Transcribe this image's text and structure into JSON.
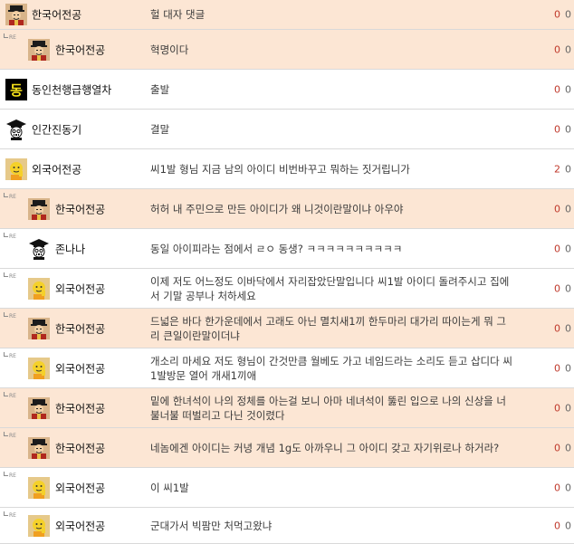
{
  "labels": {
    "reply_marker": "RE"
  },
  "comments": [
    {
      "nick": "한국어전공",
      "avatar": "king",
      "reply": false,
      "hl": true,
      "text": "헐 대자 댓글",
      "c1": "0",
      "c2": "0"
    },
    {
      "nick": "한국어전공",
      "avatar": "king",
      "reply": true,
      "hl": true,
      "text": "혁명이다",
      "c1": "0",
      "c2": "0"
    },
    {
      "nick": "동인천행급행열차",
      "avatar": "dong",
      "reply": false,
      "hl": false,
      "text": "출발",
      "c1": "0",
      "c2": "0"
    },
    {
      "nick": "인간진동기",
      "avatar": "grad",
      "reply": false,
      "hl": false,
      "text": "결말",
      "c1": "0",
      "c2": "0"
    },
    {
      "nick": "외국어전공",
      "avatar": "yellow",
      "reply": false,
      "hl": false,
      "text": "씨1발 형님 지금 남의 아이디 비번바꾸고 뭐하는 짓거립니가",
      "c1": "2",
      "c2": "0"
    },
    {
      "nick": "한국어전공",
      "avatar": "king",
      "reply": true,
      "hl": true,
      "text": "허허 내 주민으로 만든 아이디가 왜 니것이란말이냐 아우야",
      "c1": "0",
      "c2": "0"
    },
    {
      "nick": "존나나",
      "avatar": "grad",
      "reply": true,
      "hl": false,
      "text": "동일 아이피라는 점에서 ㄹㅇ 동생? ㅋㅋㅋㅋㅋㅋㅋㅋㅋㅋ",
      "c1": "0",
      "c2": "0"
    },
    {
      "nick": "외국어전공",
      "avatar": "yellow",
      "reply": true,
      "hl": false,
      "text": "이제 저도 어느정도 이바닥에서 자리잡았단말입니다 씨1발 아이디 돌려주시고 집에서 기말 공부나 처하세요",
      "c1": "0",
      "c2": "0"
    },
    {
      "nick": "한국어전공",
      "avatar": "king",
      "reply": true,
      "hl": true,
      "text": "드넓은 바다 한가운데에서 고래도 아닌 멸치새1끼 한두마리 대가리 따이는게 뭐 그리 큰일이란말이더냐",
      "c1": "0",
      "c2": "0"
    },
    {
      "nick": "외국어전공",
      "avatar": "yellow",
      "reply": true,
      "hl": false,
      "text": "개소리 마세요 저도 형님이 간것만큼 월베도 가고 네임드라는 소리도 듣고 삽디다 씨1발방문 열어 개새1끼애",
      "c1": "0",
      "c2": "0"
    },
    {
      "nick": "한국어전공",
      "avatar": "king",
      "reply": true,
      "hl": true,
      "text": "밑에 한녀석이 나의 정체를 아는걸 보니 아마 네녀석이 뚫린 입으로 나의 신상을 너불너불 떠벌리고 다닌 것이렸다",
      "c1": "0",
      "c2": "0"
    },
    {
      "nick": "한국어전공",
      "avatar": "king",
      "reply": true,
      "hl": true,
      "text": "네놈에겐 아이디는 커녕 개념 1g도 아까우니 그 아이디 갖고 자기위로나 하거라?",
      "c1": "0",
      "c2": "0"
    },
    {
      "nick": "외국어전공",
      "avatar": "yellow",
      "reply": true,
      "hl": false,
      "text": "이 씨1발",
      "c1": "0",
      "c2": "0"
    },
    {
      "nick": "외국어전공",
      "avatar": "yellow",
      "reply": true,
      "hl": false,
      "text": "군대가서 빅팜만 처먹고왔냐",
      "c1": "0",
      "c2": "0"
    }
  ]
}
